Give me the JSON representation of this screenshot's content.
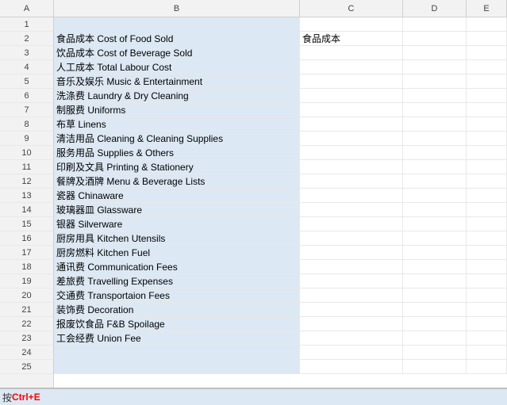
{
  "columns": {
    "headers": [
      "A",
      "B",
      "C",
      "D",
      "E"
    ]
  },
  "rows": [
    {
      "num": 1,
      "b": "",
      "c": "",
      "d": "",
      "e": ""
    },
    {
      "num": 2,
      "b": "食品成本 Cost of Food Sold",
      "c": "食品成本",
      "d": "",
      "e": ""
    },
    {
      "num": 3,
      "b": "饮品成本 Cost of Beverage Sold",
      "c": "",
      "d": "",
      "e": ""
    },
    {
      "num": 4,
      "b": "人工成本 Total Labour Cost",
      "c": "",
      "d": "",
      "e": ""
    },
    {
      "num": 5,
      "b": "音乐及娱乐 Music & Entertainment",
      "c": "",
      "d": "",
      "e": ""
    },
    {
      "num": 6,
      "b": "洗涤费 Laundry & Dry Cleaning",
      "c": "",
      "d": "",
      "e": ""
    },
    {
      "num": 7,
      "b": "制服费 Uniforms",
      "c": "",
      "d": "",
      "e": ""
    },
    {
      "num": 8,
      "b": "布草 Linens",
      "c": "",
      "d": "",
      "e": ""
    },
    {
      "num": 9,
      "b": "清洁用品 Cleaning & Cleaning Supplies",
      "c": "",
      "d": "",
      "e": ""
    },
    {
      "num": 10,
      "b": "服务用品 Supplies & Others",
      "c": "",
      "d": "",
      "e": ""
    },
    {
      "num": 11,
      "b": "印刷及文具 Printing & Stationery",
      "c": "",
      "d": "",
      "e": ""
    },
    {
      "num": 12,
      "b": "餐牌及酒牌 Menu & Beverage Lists",
      "c": "",
      "d": "",
      "e": ""
    },
    {
      "num": 13,
      "b": "瓷器 Chinaware",
      "c": "",
      "d": "",
      "e": ""
    },
    {
      "num": 14,
      "b": "玻璃器皿 Glassware",
      "c": "",
      "d": "",
      "e": ""
    },
    {
      "num": 15,
      "b": "银器 Silverware",
      "c": "",
      "d": "",
      "e": ""
    },
    {
      "num": 16,
      "b": "厨房用具 Kitchen Utensils",
      "c": "",
      "d": "",
      "e": ""
    },
    {
      "num": 17,
      "b": "厨房燃料 Kitchen Fuel",
      "c": "",
      "d": "",
      "e": ""
    },
    {
      "num": 18,
      "b": "通讯费 Communication Fees",
      "c": "",
      "d": "",
      "e": ""
    },
    {
      "num": 19,
      "b": "差旅费 Travelling Expenses",
      "c": "",
      "d": "",
      "e": ""
    },
    {
      "num": 20,
      "b": "交通费 Transportaion Fees",
      "c": "",
      "d": "",
      "e": ""
    },
    {
      "num": 21,
      "b": "装饰费 Decoration",
      "c": "",
      "d": "",
      "e": ""
    },
    {
      "num": 22,
      "b": "报废饮食品 F&B Spoilage",
      "c": "",
      "d": "",
      "e": ""
    },
    {
      "num": 23,
      "b": "工会经费 Union Fee",
      "c": "",
      "d": "",
      "e": ""
    },
    {
      "num": 24,
      "b": "",
      "c": "",
      "d": "",
      "e": ""
    },
    {
      "num": 25,
      "b": "",
      "c": "",
      "d": "",
      "e": ""
    }
  ],
  "hint": {
    "prefix": "按",
    "shortcut": "Ctrl+E",
    "suffix": ""
  },
  "colors": {
    "cell_selected_bg": "#dce8f3",
    "cell_first_bg": "#c5ddf5",
    "header_bg": "#f2f2f2",
    "accent": "#ff0000"
  }
}
